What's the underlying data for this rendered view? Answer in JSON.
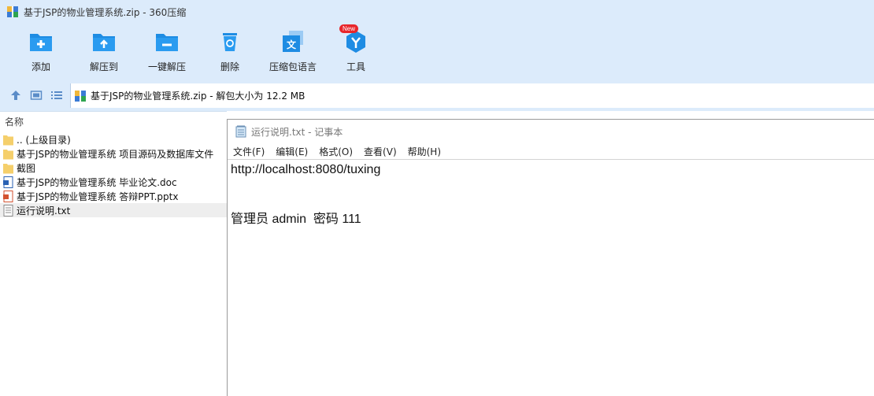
{
  "window": {
    "title": "基于JSP的物业管理系统.zip - 360压缩"
  },
  "toolbar": {
    "items": [
      {
        "label": "添加",
        "icon": "add-folder-icon"
      },
      {
        "label": "解压到",
        "icon": "extract-to-icon"
      },
      {
        "label": "一键解压",
        "icon": "one-click-extract-icon"
      },
      {
        "label": "删除",
        "icon": "delete-icon"
      },
      {
        "label": "压缩包语言",
        "icon": "archive-language-icon"
      },
      {
        "label": "工具",
        "icon": "tools-icon",
        "badge": "New"
      }
    ]
  },
  "address": {
    "path": "基于JSP的物业管理系统.zip - 解包大小为 12.2 MB"
  },
  "file_list": {
    "column_name": "名称",
    "items": [
      {
        "name": ".. (上级目录)",
        "type": "folder"
      },
      {
        "name": "基于JSP的物业管理系统 项目源码及数据库文件",
        "type": "folder"
      },
      {
        "name": "截图",
        "type": "folder"
      },
      {
        "name": "基于JSP的物业管理系统 毕业论文.doc",
        "type": "doc"
      },
      {
        "name": "基于JSP的物业管理系统 答辩PPT.pptx",
        "type": "pptx"
      },
      {
        "name": "运行说明.txt",
        "type": "txt",
        "selected": true
      }
    ]
  },
  "notepad": {
    "title": "运行说明.txt - 记事本",
    "menu": [
      "文件(F)",
      "编辑(E)",
      "格式(O)",
      "查看(V)",
      "帮助(H)"
    ],
    "lines": [
      "http://localhost:8080/tuxing",
      "",
      "",
      "管理员 admin  密码 111"
    ]
  },
  "colors": {
    "chrome_bg": "#dcebfb",
    "icon_blue": "#1e8ce3",
    "badge_red": "#e8262b",
    "selection": "#eeeeee"
  }
}
